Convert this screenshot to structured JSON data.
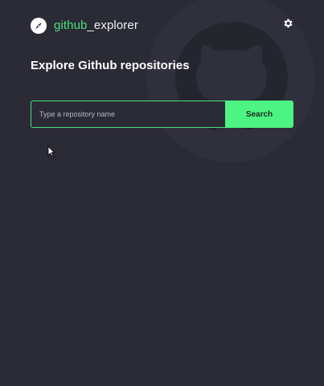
{
  "header": {
    "brand_accent": "github",
    "brand_rest": "_explorer",
    "logo_icon": "compass-icon",
    "settings_icon": "gear-icon"
  },
  "main": {
    "title": "Explore Github repositories"
  },
  "search": {
    "placeholder": "Type a repository name",
    "value": "",
    "button_label": "Search"
  },
  "colors": {
    "background": "#2a2b35",
    "accent": "#4ce07d",
    "button": "#4cf582"
  }
}
